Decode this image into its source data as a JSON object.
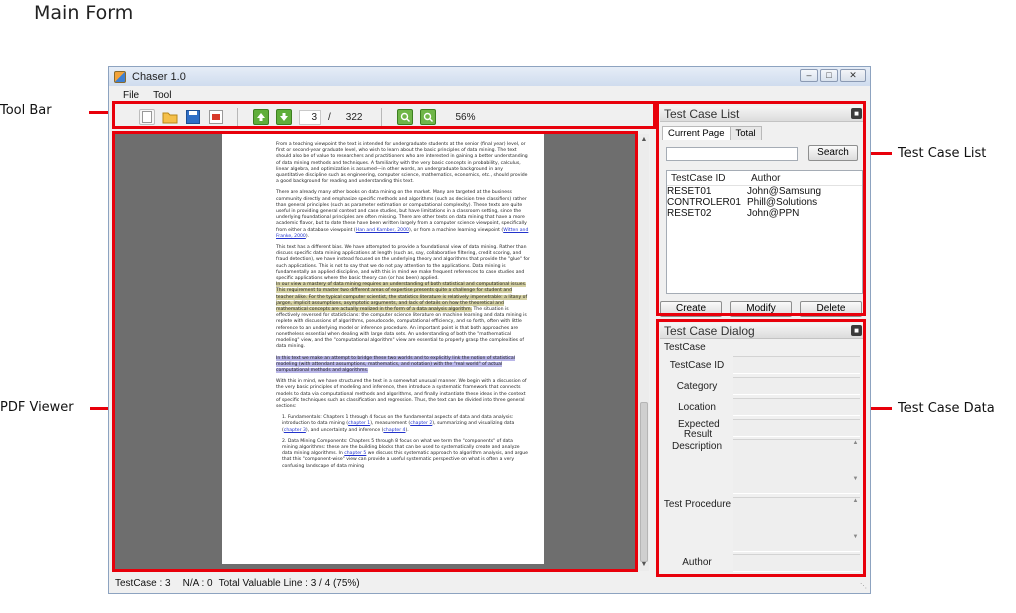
{
  "annotations": {
    "page_title": "Main Form",
    "tool_bar": "Tool Bar",
    "pdf_viewer": "PDF Viewer",
    "test_case_list": "Test Case List",
    "test_case_data": "Test Case Data"
  },
  "window": {
    "title": "Chaser 1.0",
    "controls": {
      "minimize": "–",
      "maximize": "□",
      "close": "✕"
    }
  },
  "menu": [
    "File",
    "Tool"
  ],
  "toolbar": {
    "current_page": "3",
    "separator": "/",
    "total_pages": "322",
    "zoom": "56%",
    "icons": [
      "new-file-icon",
      "open-folder-icon",
      "save-icon",
      "pdf-icon",
      "page-up-icon",
      "page-down-icon",
      "zoom-in-icon",
      "zoom-out-icon"
    ]
  },
  "pdf_text": {
    "p1": "From a teaching viewpoint the text is intended for undergraduate students at the senior (final year) level, or first or second-year graduate level, who wish to learn about the basic principles of data mining. The text should also be of value to researchers and practitioners who are interested in gaining a better understanding of data mining methods and techniques. A familiarity with the very basic concepts in probability, calculus, linear algebra, and optimization is assumed—in other words, an undergraduate background in any quantitative discipline such as engineering, computer science, mathematics, economics, etc., should provide a good background for reading and understanding this text.",
    "p2a": "There are already many other books on data mining on the market. Many are targeted at the business community directly and emphasize specific methods and algorithms (such as decision tree classifiers) rather than general principles (such as parameter estimation or computational complexity). These texts are quite useful in providing general context and case studies, but have limitations in a classroom setting, since the underlying foundational principles are often missing. There are other texts on data mining that have a more academic flavor, but to date these have been written largely from a computer science viewpoint, specifically from either a database viewpoint (",
    "p2_link1": "Han and Kamber, 2000",
    "p2b": "), or from a machine learning viewpoint (",
    "p2_link2": "Witten and Franke, 2000",
    "p2c": ").",
    "p3a": "This text has a different bias. We have attempted to provide a foundational view of data mining. Rather than discuss specific data mining applications at length (such as, say, collaborative filtering, credit scoring, and fraud detection), we have instead focused on the underlying theory and algorithms that provide the \"glue\" for such applications. This is not to say that we do not pay attention to the applications. Data mining is fundamentally an applied discipline, and with this in mind we make frequent references to case studies and specific applications where the basic theory can (or has been) applied.",
    "p3_hl": "In our view a mastery of data mining requires an understanding of both statistical and computational issues. This requirement to master two different areas of expertise presents quite a challenge for student and teacher alike. For the typical computer scientist, the statistics literature is relatively impenetrable: a litany of jargon, implicit assumptions, asymptotic arguments, and lack of details on how the theoretical and mathematical concepts are actually realized in the form of a data analysis algorithm.",
    "p3b": "The situation is effectively reversed for statisticians: the computer science literature on machine learning and data mining is replete with discussions of algorithms, pseudocode, computational efficiency, and so forth, often with little reference to an underlying model or inference procedure. An important point is that both approaches are nonetheless essential when dealing with large data sets. An understanding of both the \"mathematical modeling\" view, and the \"computational algorithm\" view are essential to properly grasp the complexities of data mining.",
    "p4_hl": "In this text we make an attempt to bridge these two worlds and to explicitly link the notion of statistical modeling (with attendant assumptions, mathematics, and notation) with the \"real world\" of actual computational methods and algorithms.",
    "p5": "With this in mind, we have structured the text in a somewhat unusual manner. We begin with a discussion of the very basic principles of modeling and inference, then introduce a systematic framework that connects models to data via computational methods and algorithms, and finally instantiate these ideas in the context of specific techniques such as classification and regression. Thus, the text can be divided into three general sections:",
    "li1a": "1. Fundamentals: Chapters 1 through 4 focus on the fundamental aspects of data and data analysis: introduction to data mining (",
    "li1_link1": "chapter 1",
    "li1b": "), measurement (",
    "li1_link2": "chapter 2",
    "li1c": "), summarizing and visualizing data (",
    "li1_link3": "chapter 3",
    "li1d": "), and uncertainty and inference (",
    "li1_link4": "chapter 4",
    "li1e": ").",
    "li2a": "2. Data Mining Components: Chapters 5 through 8 focus on what we term the \"components\" of data mining algorithms: these are the building blocks that can be used to systematically create and analyze data mining algorithms. In ",
    "li2_link": "chapter 5",
    "li2b": " we discuss this systematic approach to algorithm analysis, and argue that this \"component-wise\" view can provide a useful systematic perspective on what is often a very confusing landscape of data mining"
  },
  "status": {
    "testcase": "TestCase : 3",
    "na": "N/A : 0",
    "valuable": "Total Valuable Line : 3 / 4 (75%)"
  },
  "list_panel": {
    "title": "Test Case List",
    "tabs": [
      "Current Page",
      "Total"
    ],
    "search_value": "",
    "search_button": "Search",
    "columns": [
      "TestCase ID",
      "Author"
    ],
    "rows": [
      [
        "RESET01",
        "John@Samsung"
      ],
      [
        "CONTROLER01",
        "Phill@Solutions"
      ],
      [
        "RESET02",
        "John@PPN"
      ]
    ],
    "buttons": [
      "Create",
      "Modify",
      "Delete"
    ]
  },
  "dialog_panel": {
    "title": "Test Case Dialog",
    "group_label": "TestCase",
    "fields": {
      "testcase_id": "TestCase  ID",
      "category": "Category",
      "location": "Location",
      "expected_result": "Expected Result",
      "description": "Description",
      "test_procedure": "Test Procedure",
      "author": "Author"
    }
  },
  "colors": {
    "annotation_red": "#e8000b",
    "viewer_bg": "#6e6e6e",
    "link": "#2233cc"
  }
}
